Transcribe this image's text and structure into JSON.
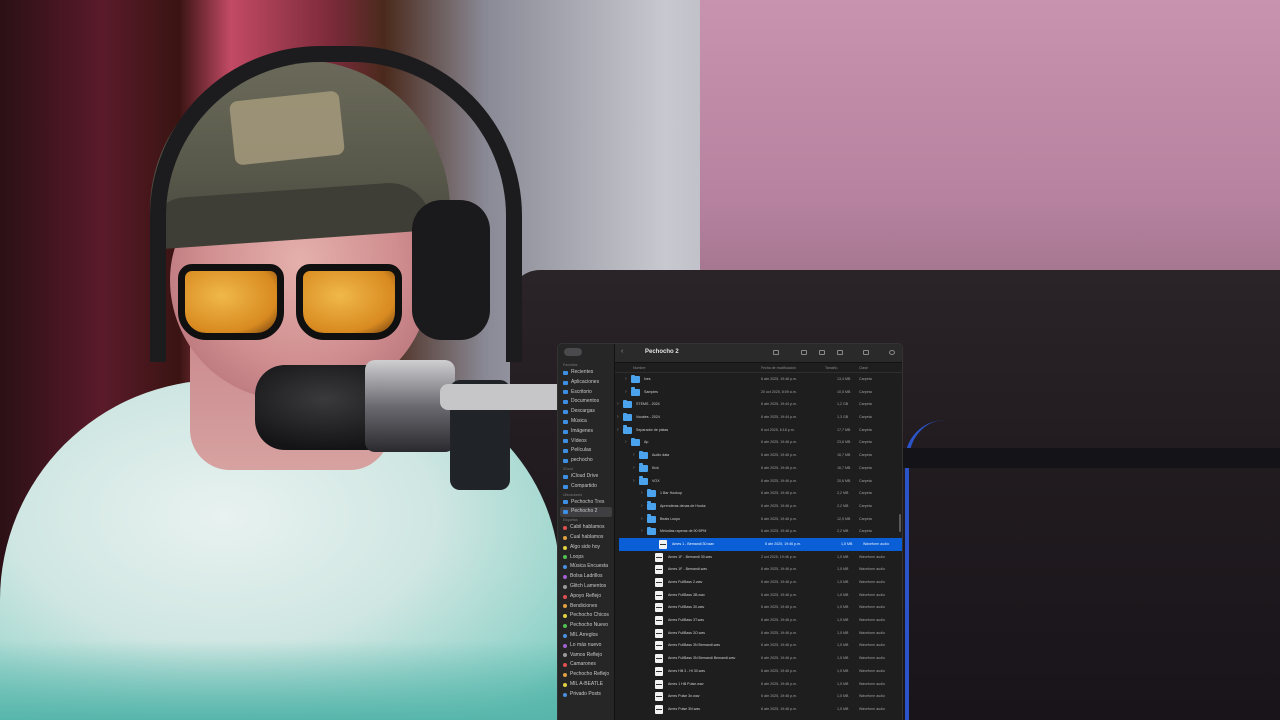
{
  "window": {
    "title": "Pechocho 2",
    "back_label": "‹"
  },
  "columns": {
    "name": "Nombre",
    "date": "Fecha de modificación",
    "size": "Tamaño",
    "kind": "Clase"
  },
  "sidebar": {
    "favorites_title": "Favoritos",
    "favorites": [
      "Recientes",
      "Aplicaciones",
      "Escritorio",
      "Documentos",
      "Descargas",
      "Música",
      "Imágenes",
      "Vídeos",
      "Películas",
      "pechocho"
    ],
    "icloud_title": "iCloud",
    "icloud": [
      "iCloud Drive",
      "Compartido"
    ],
    "locations_title": "Ubicaciones",
    "locations": [
      "Pechocho Tres",
      "Pechocho 2"
    ],
    "tags_title": "Etiquetas",
    "tags": [
      {
        "label": "Cabil hablamos",
        "color": "#e05050"
      },
      {
        "label": "Cual hablamos",
        "color": "#e0a040"
      },
      {
        "label": "Algo sido hoy",
        "color": "#e0d040"
      },
      {
        "label": "Loops",
        "color": "#50c050"
      },
      {
        "label": "Música Encuesta",
        "color": "#4a90e0"
      },
      {
        "label": "Bolsa Ladrillos",
        "color": "#a060d0"
      },
      {
        "label": "Glitch Lamentos",
        "color": "#9a9a9a"
      },
      {
        "label": "Apoyo Reflejo",
        "color": "#e05050"
      },
      {
        "label": "Bendiciones",
        "color": "#e0a040"
      },
      {
        "label": "Pechocho Chicos",
        "color": "#e0d040"
      },
      {
        "label": "Pechocho Nuevo",
        "color": "#50c050"
      },
      {
        "label": "MIL Arreglos",
        "color": "#4a90e0"
      },
      {
        "label": "Lo más nuevo",
        "color": "#a060d0"
      },
      {
        "label": "Vamos Reflejo",
        "color": "#9a9a9a"
      },
      {
        "label": "Camarones",
        "color": "#e05050"
      },
      {
        "label": "Pechocho Reflejo",
        "color": "#e0a040"
      },
      {
        "label": "MIL A-BEATLE",
        "color": "#e0d040"
      },
      {
        "label": "Privado Posts",
        "color": "#4a90e0"
      }
    ]
  },
  "files": [
    {
      "name": "Ixes",
      "date": "6 abr 2025, 19:46 p.m.",
      "size": "13,4 MB",
      "kind": "Carpeta",
      "type": "folder",
      "indent": 1,
      "selected": false
    },
    {
      "name": "Samples",
      "date": "20 oct 2025, 8:09 a.m.",
      "size": "10,5 MB",
      "kind": "Carpeta",
      "type": "folder",
      "indent": 1,
      "selected": false
    },
    {
      "name": "STEMS - 2024",
      "date": "6 abr 2025, 19:44 p.m.",
      "size": "1,2 GB",
      "kind": "Carpeta",
      "type": "folder",
      "indent": 0,
      "selected": false
    },
    {
      "name": "Vocales - 2024",
      "date": "6 abr 2025, 19:44 p.m.",
      "size": "1,3 GB",
      "kind": "Carpeta",
      "type": "folder",
      "indent": 0,
      "selected": false
    },
    {
      "name": "Separador de pistas",
      "date": "6 oct 2025, 6:18 p.m.",
      "size": "17,7 MB",
      "kind": "Carpeta",
      "type": "folder",
      "indent": 0,
      "selected": false
    },
    {
      "name": "Ap",
      "date": "6 abr 2025, 19:46 p.m.",
      "size": "23,6 MB",
      "kind": "Carpeta",
      "type": "folder",
      "indent": 1,
      "selected": false
    },
    {
      "name": "Audio data",
      "date": "6 abr 2025, 19:46 p.m.",
      "size": "16,7 MB",
      "kind": "Carpeta",
      "type": "folder",
      "indent": 2,
      "selected": false
    },
    {
      "name": "Kick",
      "date": "6 abr 2025, 19:46 p.m.",
      "size": "16,7 MB",
      "kind": "Carpeta",
      "type": "folder",
      "indent": 2,
      "selected": false
    },
    {
      "name": "VOX",
      "date": "6 abr 2025, 19:46 p.m.",
      "size": "20,6 MB",
      "kind": "Carpeta",
      "type": "folder",
      "indent": 2,
      "selected": false
    },
    {
      "name": "1 Bar Hookup",
      "date": "6 abr 2025, 19:46 p.m.",
      "size": "2,2 MB",
      "kind": "Carpeta",
      "type": "folder",
      "indent": 3,
      "selected": false
    },
    {
      "name": "Aprenderas denas de Hooks",
      "date": "6 abr 2025, 19:46 p.m.",
      "size": "2,2 MB",
      "kind": "Carpeta",
      "type": "folder",
      "indent": 3,
      "selected": false
    },
    {
      "name": "Beats Loops",
      "date": "6 abr 2025, 19:46 p.m.",
      "size": "12,5 MB",
      "kind": "Carpeta",
      "type": "folder",
      "indent": 3,
      "selected": false
    },
    {
      "name": "Melodias raperas de 90 BPM",
      "date": "6 abr 2025, 19:46 p.m.",
      "size": "2,2 MB",
      "kind": "Carpeta",
      "type": "folder",
      "indent": 3,
      "selected": false
    },
    {
      "name": "Ames 1 - Bemandi 30.wav",
      "date": "6 abr 2025, 19:46 p.m.",
      "size": "1,5 MB",
      "kind": "Waveform audio",
      "type": "wav",
      "indent": 4,
      "selected": true
    },
    {
      "name": "Ames 1F - Bemandi 30.wav",
      "date": "2 oct 2025, 19:46 p.m.",
      "size": "1,5 MB",
      "kind": "Waveform audio",
      "type": "wav",
      "indent": 4,
      "selected": false
    },
    {
      "name": "Ames 1F - Bemandi.wav",
      "date": "6 abr 2025, 19:46 p.m.",
      "size": "1,5 MB",
      "kind": "Waveform audio",
      "type": "wav",
      "indent": 4,
      "selected": false
    },
    {
      "name": "Ames FullBass 2.wav",
      "date": "6 abr 2025, 19:46 p.m.",
      "size": "1,5 MB",
      "kind": "Waveform audio",
      "type": "wav",
      "indent": 4,
      "selected": false
    },
    {
      "name": "Ames FullBass 3B.wav",
      "date": "6 abr 2025, 19:46 p.m.",
      "size": "1,5 MB",
      "kind": "Waveform audio",
      "type": "wav",
      "indent": 4,
      "selected": false
    },
    {
      "name": "Ames FullBass 30.wav",
      "date": "6 abr 2025, 19:46 p.m.",
      "size": "1,5 MB",
      "kind": "Waveform audio",
      "type": "wav",
      "indent": 4,
      "selected": false
    },
    {
      "name": "Ames FullBass 3T.wav",
      "date": "6 abr 2025, 19:46 p.m.",
      "size": "1,5 MB",
      "kind": "Waveform audio",
      "type": "wav",
      "indent": 4,
      "selected": false
    },
    {
      "name": "Ames FullBass 3O.wav",
      "date": "6 abr 2025, 19:46 p.m.",
      "size": "1,5 MB",
      "kind": "Waveform audio",
      "type": "wav",
      "indent": 4,
      "selected": false
    },
    {
      "name": "Ames FullBass 3N Bemandi.wav",
      "date": "6 abr 2025, 19:46 p.m.",
      "size": "1,5 MB",
      "kind": "Waveform audio",
      "type": "wav",
      "indent": 4,
      "selected": false
    },
    {
      "name": "Ames FullBass 3N Bemandi Bemandi.wav",
      "date": "6 abr 2025, 19:46 p.m.",
      "size": "1,5 MB",
      "kind": "Waveform audio",
      "type": "wav",
      "indent": 4,
      "selected": false
    },
    {
      "name": "Ames Hill 3 - Hi 30.wav",
      "date": "6 abr 2025, 19:46 p.m.",
      "size": "1,5 MB",
      "kind": "Waveform audio",
      "type": "wav",
      "indent": 4,
      "selected": false
    },
    {
      "name": "Ames 1 Hill Pulse.wav",
      "date": "6 abr 2025, 19:46 p.m.",
      "size": "1,5 MB",
      "kind": "Waveform audio",
      "type": "wav",
      "indent": 4,
      "selected": false
    },
    {
      "name": "Ames Pulse 3n.wav",
      "date": "6 abr 2025, 19:46 p.m.",
      "size": "1,5 MB",
      "kind": "Waveform audio",
      "type": "wav",
      "indent": 4,
      "selected": false
    },
    {
      "name": "Ames Pulse 3N.wav",
      "date": "6 abr 2025, 19:46 p.m.",
      "size": "1,5 MB",
      "kind": "Waveform audio",
      "type": "wav",
      "indent": 4,
      "selected": false
    }
  ],
  "colors": {
    "accent": "#0a5fd6",
    "folder": "#4ba3ee",
    "window_bg": "#1e1e1e"
  },
  "icons": [
    "back-chevron-icon",
    "view-options-icon",
    "share-icon",
    "tag-icon",
    "action-icon",
    "search-icon",
    "folder-icon",
    "waveform-file-icon"
  ]
}
